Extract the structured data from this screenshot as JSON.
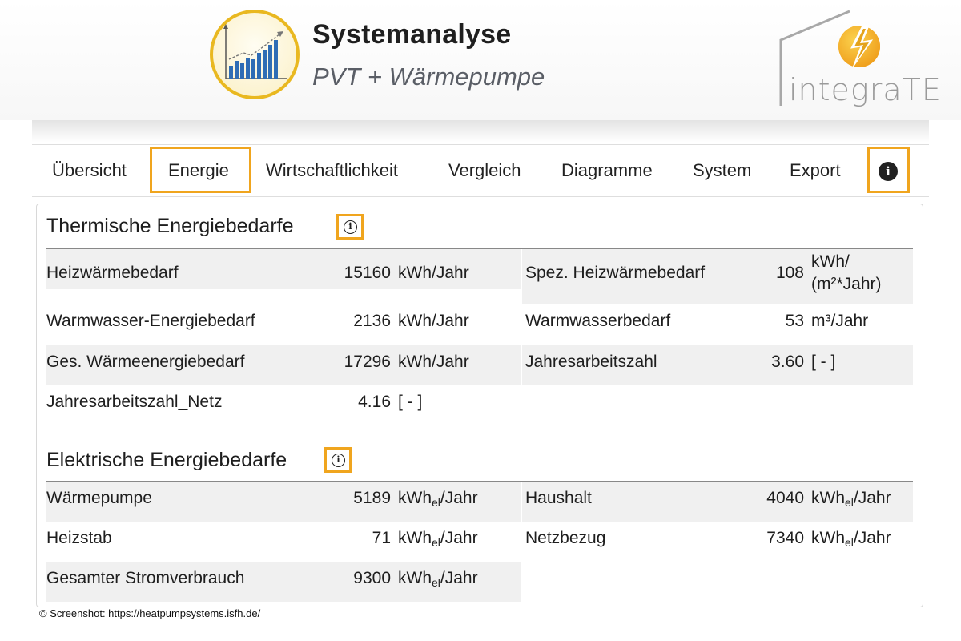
{
  "header": {
    "title": "Systemanalyse",
    "subtitle": "PVT + Wärmepumpe",
    "brand": "integraTE",
    "colors": {
      "accent": "#f0a51e",
      "logo_ring": "#e9b820",
      "bars": "#2f6db5"
    }
  },
  "nav": {
    "tabs": [
      "Übersicht",
      "Energie",
      "Wirtschaftlichkeit",
      "Vergleich",
      "Diagramme",
      "System",
      "Export"
    ],
    "active_tab": "Energie",
    "info_icon": "info-icon"
  },
  "thermal": {
    "title": "Thermische Energiebedarfe",
    "left": [
      {
        "label": "Heizwärmebedarf",
        "value": "15160",
        "unit": "kWh/Jahr"
      },
      {
        "label": "Warmwasser-Energiebedarf",
        "value": "2136",
        "unit": "kWh/Jahr"
      },
      {
        "label": "Ges. Wärmeenergiebedarf",
        "value": "17296",
        "unit": "kWh/Jahr"
      },
      {
        "label": "Jahresarbeitszahl_Netz",
        "value": "4.16",
        "unit": "[ - ]"
      }
    ],
    "right": [
      {
        "label": "Spez. Heizwärmebedarf",
        "value": "108",
        "unit_line1": "kWh/",
        "unit_line2": "(m²*Jahr)"
      },
      {
        "label": "Warmwasserbedarf",
        "value": "53",
        "unit": "m³/Jahr"
      },
      {
        "label": "Jahresarbeitszahl",
        "value": "3.60",
        "unit": "[ - ]"
      }
    ]
  },
  "electric": {
    "title": "Elektrische Energiebedarfe",
    "unit_base": "kWh",
    "unit_sub": "el",
    "unit_tail": "/Jahr",
    "left": [
      {
        "label": "Wärmepumpe",
        "value": "5189"
      },
      {
        "label": "Heizstab",
        "value": "71"
      },
      {
        "label": "Gesamter Stromverbrauch",
        "value": "9300"
      }
    ],
    "right": [
      {
        "label": "Haushalt",
        "value": "4040"
      },
      {
        "label": "Netzbezug",
        "value": "7340"
      }
    ]
  },
  "footer": {
    "copyright": "© Screenshot: https://heatpumpsystems.isfh.de/"
  }
}
